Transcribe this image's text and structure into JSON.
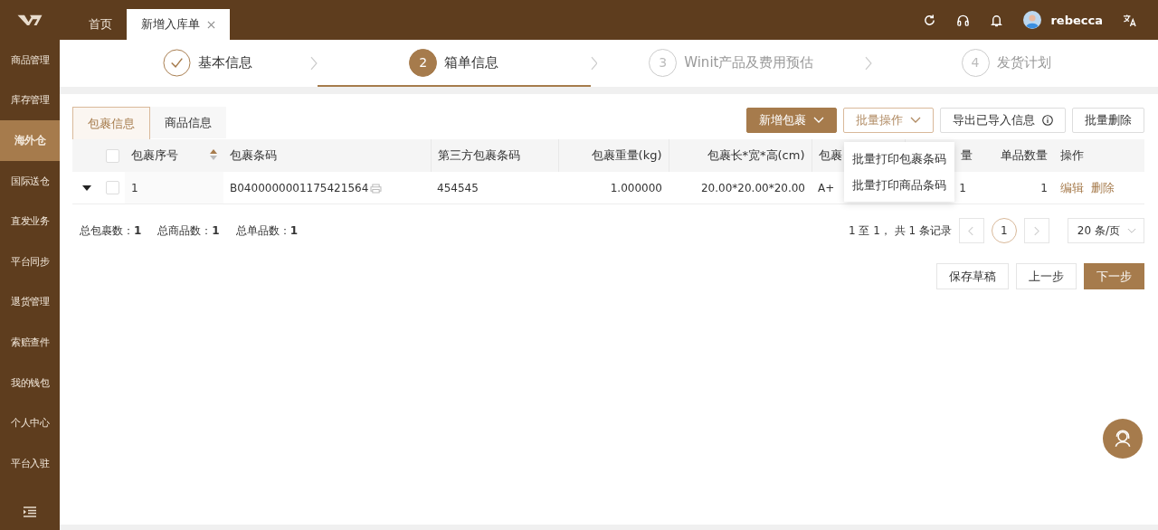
{
  "sidebar": {
    "items": [
      {
        "label": "商品管理",
        "selected": false
      },
      {
        "label": "库存管理",
        "selected": false
      },
      {
        "label": "海外仓",
        "selected": true
      },
      {
        "label": "国际送仓",
        "selected": false
      },
      {
        "label": "直发业务",
        "selected": false
      },
      {
        "label": "平台同步",
        "selected": false
      },
      {
        "label": "退货管理",
        "selected": false
      },
      {
        "label": "索赔查件",
        "selected": false
      },
      {
        "label": "我的钱包",
        "selected": false
      },
      {
        "label": "个人中心",
        "selected": false
      },
      {
        "label": "平台入驻",
        "selected": false
      }
    ]
  },
  "top_tabs": [
    {
      "label": "首页",
      "selected": false,
      "closable": false
    },
    {
      "label": "新增入库单",
      "selected": true,
      "closable": true
    }
  ],
  "user": {
    "name": "rebecca"
  },
  "steps": [
    {
      "label": "基本信息",
      "completed": true,
      "selected": false
    },
    {
      "number": "2",
      "label": "箱单信息",
      "completed": false,
      "selected": true
    },
    {
      "number": "3",
      "label": "Winit产品及费用预估",
      "completed": false,
      "selected": false
    },
    {
      "number": "4",
      "label": "发货计划",
      "completed": false,
      "selected": false
    }
  ],
  "content_tabs": [
    {
      "label": "包裹信息",
      "selected": true
    },
    {
      "label": "商品信息",
      "selected": false
    }
  ],
  "toolbar": [
    {
      "label": "新增包裹",
      "kind": "primary-dropdown"
    },
    {
      "label": "批量操作",
      "kind": "dropdown"
    },
    {
      "label": "导出已导入信息",
      "kind": "info"
    },
    {
      "label": "批量删除",
      "kind": "plain"
    }
  ],
  "dropdown_menu": [
    "批量打印包裹条码",
    "批量打印商品条码"
  ],
  "table": {
    "header_checked": false,
    "columns": [
      {
        "label": "包裹序号"
      },
      {
        "label": "包裹条码"
      },
      {
        "label": "第三方包裹条码"
      },
      {
        "label": "包裹重量(kg)"
      },
      {
        "label": "包裹长*宽*高(cm)"
      },
      {
        "label": "包裹"
      },
      {
        "label": "量"
      },
      {
        "label": "单品数量"
      },
      {
        "label": "操作"
      }
    ],
    "rows": [
      {
        "checked": false,
        "cells": [
          "1",
          "B0400000001175421564",
          "454545",
          "1.000000",
          "20.00*20.00*20.00",
          "A+",
          "1",
          "1"
        ],
        "actions": [
          "编辑",
          "删除"
        ]
      }
    ]
  },
  "totals": [
    "总包裹数：**1**",
    "总商品数：**1**",
    "总单品数：**1**"
  ],
  "pagination": {
    "summary": "1 至 1， 共 1 条记录",
    "pages": [
      {
        "label": "1",
        "selected": true
      }
    ],
    "page_size": "20 条/页"
  },
  "footer_buttons": [
    {
      "label": "保存草稿",
      "kind": "default"
    },
    {
      "label": "上一步",
      "kind": "default"
    },
    {
      "label": "下一步",
      "kind": "primary"
    }
  ]
}
